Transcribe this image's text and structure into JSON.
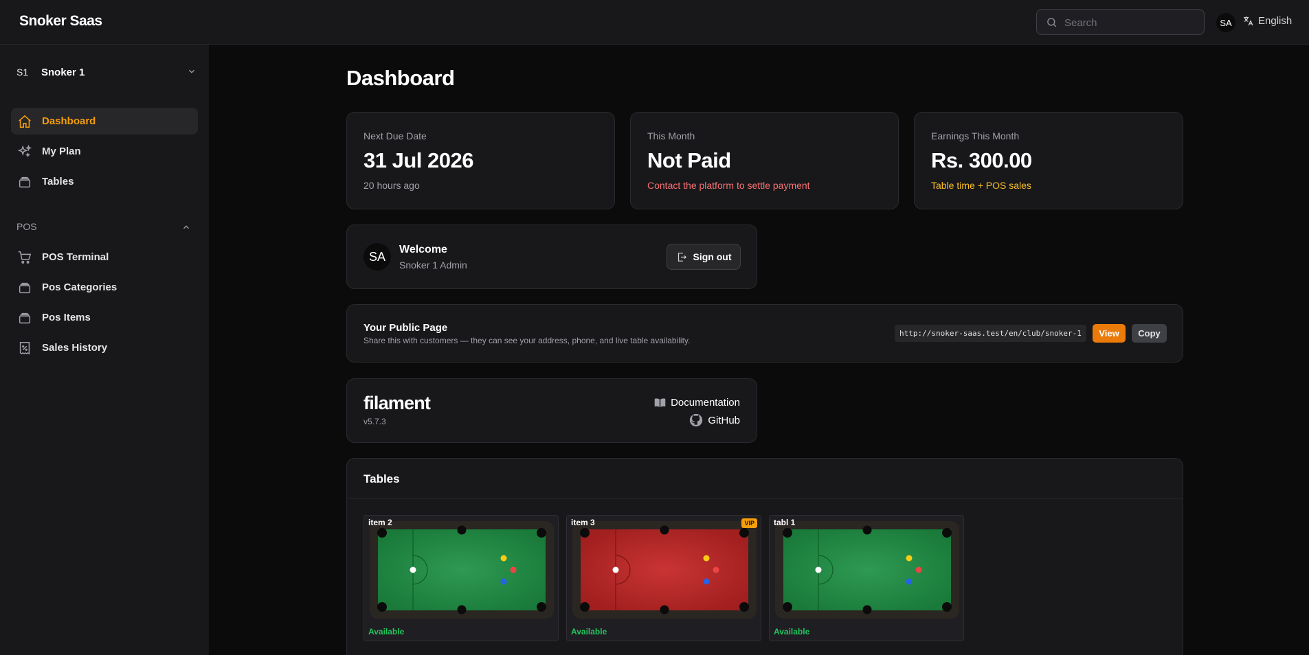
{
  "topbar": {
    "brand": "Snoker Saas",
    "search_placeholder": "Search",
    "avatar_initials": "SA",
    "language": "English"
  },
  "sidebar": {
    "tenant": {
      "initials": "S1",
      "name": "Snoker 1"
    },
    "items": [
      {
        "label": "Dashboard",
        "icon": "home-icon",
        "active": true
      },
      {
        "label": "My Plan",
        "icon": "sparkles-icon"
      },
      {
        "label": "Tables",
        "icon": "stack-icon"
      }
    ],
    "group": {
      "label": "POS",
      "items": [
        {
          "label": "POS Terminal",
          "icon": "cart-icon"
        },
        {
          "label": "Pos Categories",
          "icon": "stack-icon"
        },
        {
          "label": "Pos Items",
          "icon": "stack-icon"
        },
        {
          "label": "Sales History",
          "icon": "receipt-percent-icon"
        }
      ]
    }
  },
  "main": {
    "title": "Dashboard",
    "stats": [
      {
        "label": "Next Due Date",
        "value": "31 Jul 2026",
        "desc": "20 hours ago",
        "desc_color": "#a1a1aa"
      },
      {
        "label": "This Month",
        "value": "Not Paid",
        "desc": "Contact the platform to settle payment",
        "desc_color": "#f87171"
      },
      {
        "label": "Earnings This Month",
        "value": "Rs. 300.00",
        "desc": "Table time + POS sales",
        "desc_color": "#fbbf24"
      }
    ],
    "welcome": {
      "initials": "SA",
      "title": "Welcome",
      "subtitle": "Snoker 1 Admin",
      "signout_label": "Sign out"
    },
    "public_page": {
      "title": "Your Public Page",
      "subtitle": "Share this with customers — they can see your address, phone, and live table availability.",
      "url": "http://snoker-saas.test/en/club/snoker-1",
      "view_label": "View",
      "copy_label": "Copy"
    },
    "filament": {
      "logo": "filament",
      "version": "v5.7.3",
      "docs_label": "Documentation",
      "github_label": "GitHub"
    },
    "tables": {
      "heading": "Tables",
      "items": [
        {
          "name": "item 2",
          "status": "Available",
          "felt": "green",
          "vip": false
        },
        {
          "name": "item 3",
          "status": "Available",
          "felt": "red",
          "vip": true,
          "badge": "VIP"
        },
        {
          "name": "tabl 1",
          "status": "Available",
          "felt": "green",
          "vip": false
        }
      ]
    }
  },
  "colors": {
    "accent": "#f59e0b",
    "primary_button": "#ea7a0a",
    "available": "#22c55e"
  }
}
